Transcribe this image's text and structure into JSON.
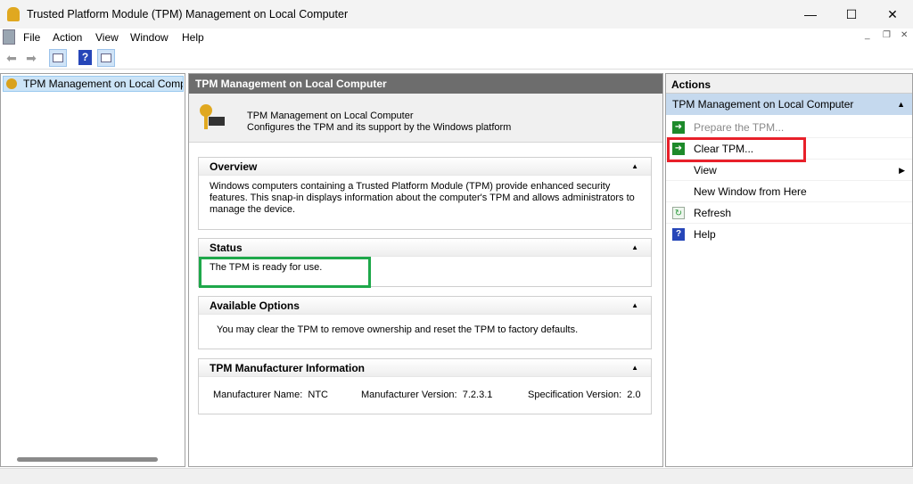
{
  "window": {
    "title": "Trusted Platform Module (TPM) Management on Local Computer",
    "minimize": "—",
    "maximize": "☐",
    "close": "✕"
  },
  "menu": [
    "File",
    "Action",
    "View",
    "Window",
    "Help"
  ],
  "tree": {
    "item": "TPM Management on Local Computer"
  },
  "center": {
    "header": "TPM Management on Local Computer",
    "banner_title": "TPM Management on Local Computer",
    "banner_desc": "Configures the TPM and its support by the Windows platform",
    "overview": {
      "title": "Overview",
      "text": "Windows computers containing a Trusted Platform Module (TPM) provide enhanced security features. This snap-in displays information about the computer's TPM and allows administrators to manage the device."
    },
    "status": {
      "title": "Status",
      "text": "The TPM is ready for use."
    },
    "options": {
      "title": "Available Options",
      "text": "You may clear the TPM to remove ownership and reset the TPM to factory defaults."
    },
    "manufacturer": {
      "title": "TPM Manufacturer Information",
      "name_label": "Manufacturer Name:",
      "name": "NTC",
      "version_label": "Manufacturer Version:",
      "version": "7.2.3.1",
      "spec_label": "Specification Version:",
      "spec": "2.0"
    }
  },
  "actions": {
    "header": "Actions",
    "group": "TPM Management on Local Computer",
    "items": [
      {
        "label": "Prepare the TPM...",
        "icon": "green-arrow-icon",
        "disabled": true
      },
      {
        "label": "Clear TPM...",
        "icon": "green-arrow-icon"
      },
      {
        "label": "View",
        "submenu": true
      },
      {
        "label": "New Window from Here"
      },
      {
        "label": "Refresh",
        "icon": "refresh-icon"
      },
      {
        "label": "Help",
        "icon": "help-icon"
      }
    ]
  },
  "colors": {
    "highlight_red": "#e8202a",
    "highlight_green": "#1ea84a",
    "action_group_bg": "#c5d9ee"
  }
}
